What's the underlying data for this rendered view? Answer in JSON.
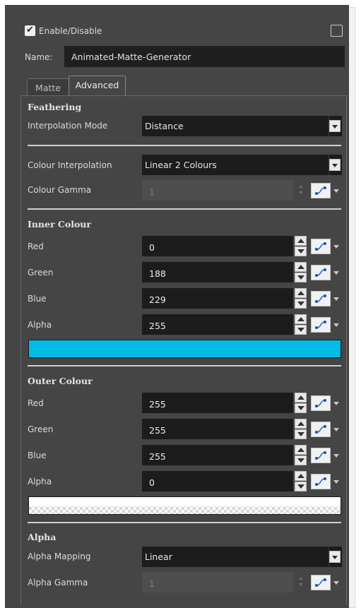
{
  "enable": {
    "label": "Enable/Disable",
    "checked": true
  },
  "name": {
    "label": "Name:",
    "value": "Animated-Matte-Generator"
  },
  "tabs": [
    {
      "label": "Matte",
      "active": false
    },
    {
      "label": "Advanced",
      "active": true
    }
  ],
  "feathering": {
    "header": "Feathering",
    "interpolation_mode": {
      "label": "Interpolation Mode",
      "value": "Distance"
    }
  },
  "colour": {
    "interpolation": {
      "label": "Colour Interpolation",
      "value": "Linear 2 Colours"
    },
    "gamma": {
      "label": "Colour Gamma",
      "value": "1"
    }
  },
  "inner": {
    "header": "Inner Colour",
    "red": {
      "label": "Red",
      "value": "0"
    },
    "green": {
      "label": "Green",
      "value": "188"
    },
    "blue": {
      "label": "Blue",
      "value": "229"
    },
    "alpha": {
      "label": "Alpha",
      "value": "255"
    },
    "swatch_color": "#00bce5"
  },
  "outer": {
    "header": "Outer Colour",
    "red": {
      "label": "Red",
      "value": "255"
    },
    "green": {
      "label": "Green",
      "value": "255"
    },
    "blue": {
      "label": "Blue",
      "value": "255"
    },
    "alpha": {
      "label": "Alpha",
      "value": "0"
    },
    "swatch_color": "#ffffff"
  },
  "alpha_section": {
    "header": "Alpha",
    "mapping": {
      "label": "Alpha Mapping",
      "value": "Linear"
    },
    "gamma": {
      "label": "Alpha Gamma",
      "value": "1"
    }
  },
  "icons": {
    "function_curve": "function-curve-icon",
    "spin": "spin-arrows-icon",
    "dropdown": "chevron-down-icon"
  },
  "colors": {
    "panel_bg": "#454545",
    "field_bg": "#1c1c1c",
    "accent_cyan": "#00bce5"
  }
}
